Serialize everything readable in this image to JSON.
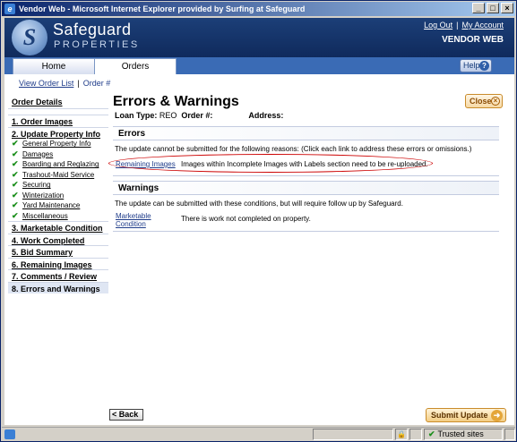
{
  "window": {
    "title": "Vendor Web - Microsoft Internet Explorer provided by Surfing at Safeguard",
    "controls": [
      "_",
      "□",
      "×"
    ]
  },
  "header": {
    "brand_line1": "Safeguard",
    "brand_line2": "PROPERTIES",
    "logo_letter": "S",
    "links": {
      "logout": "Log Out",
      "account": "My Account",
      "separator": "|"
    },
    "vendor_web": "VENDOR WEB"
  },
  "tabs": [
    {
      "label": "Home"
    },
    {
      "label": "Orders"
    }
  ],
  "help_label": "Help",
  "subnav": {
    "order_list": "View Order List",
    "separator": "|",
    "order_num": "Order #"
  },
  "sidebar": {
    "details": "Order Details",
    "items": [
      {
        "label": "1. Order Images"
      },
      {
        "label": "2. Update Property Info"
      },
      {
        "label": "3. Marketable Condition"
      },
      {
        "label": "4. Work Completed"
      },
      {
        "label": "5. Bid Summary"
      },
      {
        "label": "6. Remaining Images"
      },
      {
        "label": "7. Comments / Review"
      },
      {
        "label": "8. Errors and Warnings"
      }
    ],
    "subitems": [
      {
        "label": "General Property Info"
      },
      {
        "label": "Damages"
      },
      {
        "label": "Boarding and Reglazing"
      },
      {
        "label": "Trashout-Maid Service"
      },
      {
        "label": "Securing"
      },
      {
        "label": "Winterization"
      },
      {
        "label": "Yard Maintenance"
      },
      {
        "label": "Miscellaneous"
      }
    ]
  },
  "main": {
    "title": "Errors & Warnings",
    "loan_type_label": "Loan Type:",
    "loan_type_value": "REO",
    "order_label": "Order #:",
    "address_label": "Address:",
    "close_label": "Close"
  },
  "errors": {
    "heading": "Errors",
    "intro": "The update cannot be submitted for the following reasons: (Click each link to address these errors or omissions.)",
    "rows": [
      {
        "link": "Remaining Images",
        "message": "Images within Incomplete Images with Labels section need to be re-uploaded."
      }
    ]
  },
  "warnings": {
    "heading": "Warnings",
    "intro": "The update can be submitted with these conditions, but will require follow up by Safeguard.",
    "rows": [
      {
        "link_line1": "Marketable",
        "link_line2": "Condition",
        "message": "There is work not completed on property."
      }
    ]
  },
  "buttons": {
    "back": "< Back",
    "submit": "Submit Update"
  },
  "statusbar": {
    "zone": "Trusted sites"
  }
}
